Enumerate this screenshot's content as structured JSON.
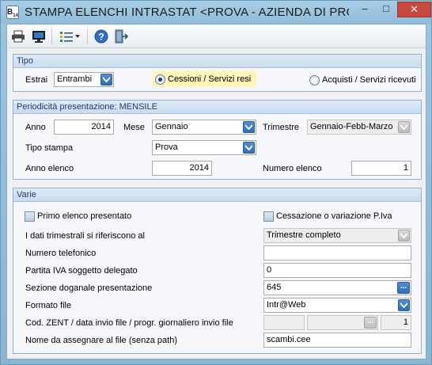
{
  "window": {
    "title": "STAMPA ELENCHI INTRASTAT <PROVA - AZIENDA DI PROV...",
    "icon_label": "B",
    "icon_sub": "14",
    "controls": {
      "minimize": "–",
      "maximize": "□",
      "close": "✕"
    }
  },
  "toolbar": {
    "items": [
      "printer-icon",
      "monitor-icon",
      "list-options-icon",
      "help-icon",
      "exit-door-icon"
    ]
  },
  "tipo": {
    "header": "Tipo",
    "estrai_label": "Estrai",
    "estrai_value": "Entrambi",
    "radio_cessioni": "Cessioni / Servizi resi",
    "radio_acquisti": "Acquisti / Servizi ricevuti"
  },
  "periodicita": {
    "header": "Periodicità presentazione: MENSILE",
    "anno_label": "Anno",
    "anno_value": "2014",
    "mese_label": "Mese",
    "mese_value": "Gennaio",
    "trimestre_label": "Trimestre",
    "trimestre_value": "Gennaio-Febb-Marzo",
    "tipo_stampa_label": "Tipo stampa",
    "tipo_stampa_value": "Prova",
    "anno_elenco_label": "Anno elenco",
    "anno_elenco_value": "2014",
    "numero_elenco_label": "Numero elenco",
    "numero_elenco_value": "1"
  },
  "varie": {
    "header": "Varie",
    "primo_elenco_label": "Primo elenco presentato",
    "cessazione_label": "Cessazione o variazione P.Iva",
    "dati_trimestrali_label": "I dati trimestrali si riferiscono al",
    "dati_trimestrali_value": "Trimestre completo",
    "telefono_label": "Numero telefonico",
    "telefono_value": "",
    "partita_iva_label": "Partita IVA soggetto delegato",
    "partita_iva_value": "0",
    "sezione_label": "Sezione doganale presentazione",
    "sezione_value": "645",
    "formato_label": "Formato file",
    "formato_value": "Intr@Web",
    "cod_zent_label": "Cod. ZENT / data invio file / progr. giornaliero invio file",
    "cod_zent_value": "",
    "data_invio_value": "",
    "progressivo_value": "1",
    "nome_file_label": "Nome da assegnare al file (senza path)",
    "nome_file_value": "scambi.cee"
  },
  "colors": {
    "accent": "#2d6fba",
    "group_header_text": "#1f3c6d",
    "highlight": "#fff4b8",
    "close_button": "#c7493e"
  }
}
